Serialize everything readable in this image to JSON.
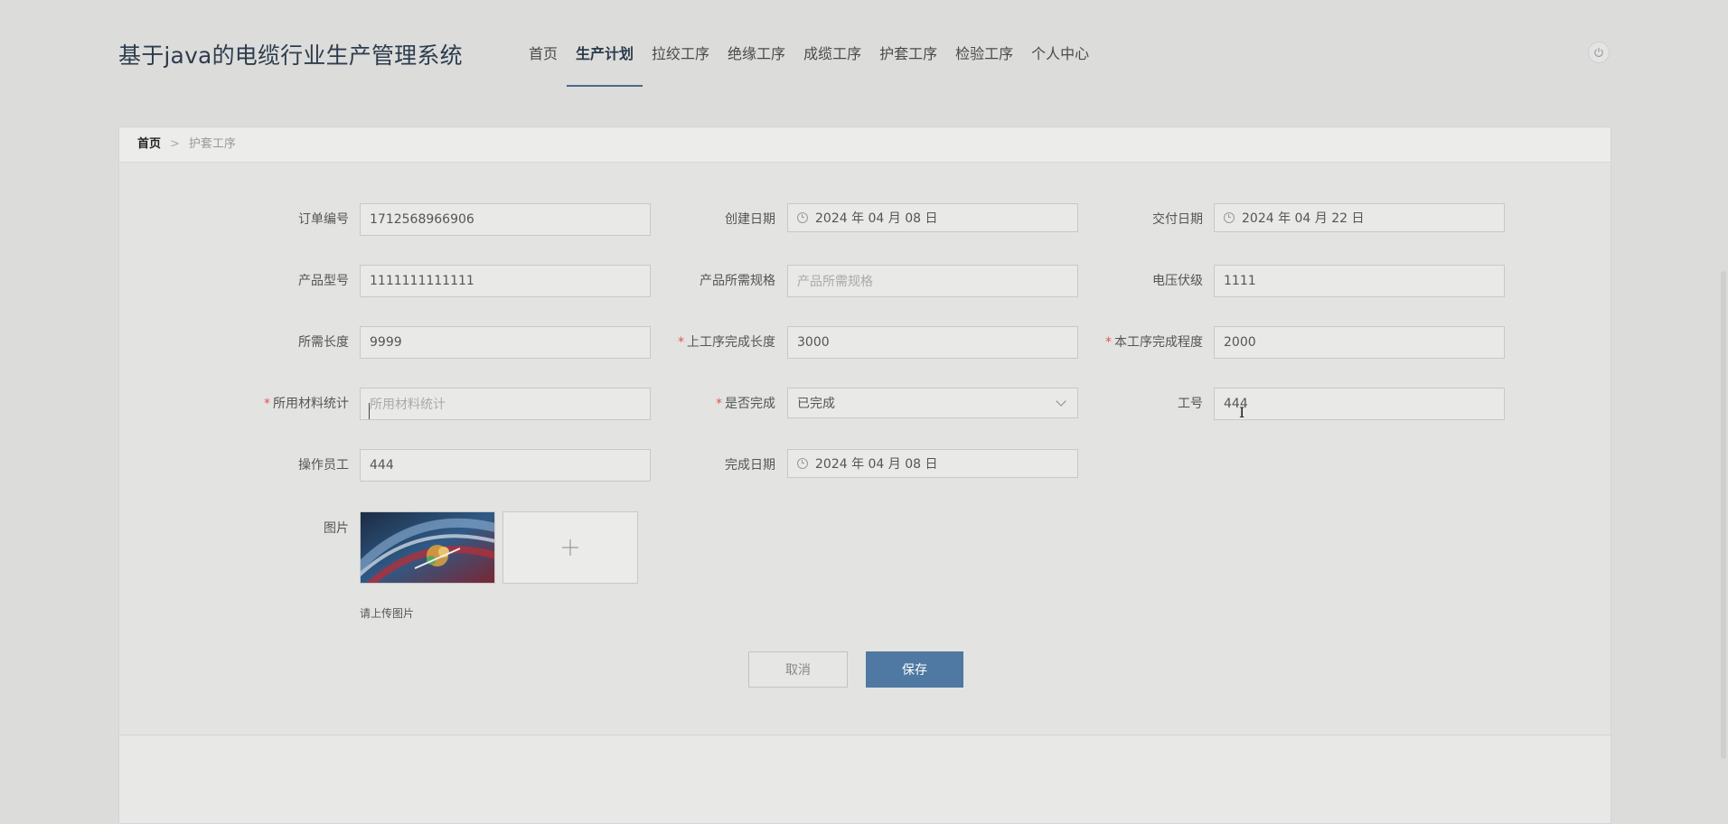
{
  "header": {
    "title": "基于java的电缆行业生产管理系统",
    "nav": [
      {
        "label": "首页",
        "active": false
      },
      {
        "label": "生产计划",
        "active": true
      },
      {
        "label": "拉绞工序",
        "active": false
      },
      {
        "label": "绝缘工序",
        "active": false
      },
      {
        "label": "成缆工序",
        "active": false
      },
      {
        "label": "护套工序",
        "active": false
      },
      {
        "label": "检验工序",
        "active": false
      },
      {
        "label": "个人中心",
        "active": false
      }
    ]
  },
  "breadcrumb": {
    "home": "首页",
    "separator": ">",
    "current": "护套工序"
  },
  "form": {
    "order_no": {
      "label": "订单编号",
      "value": "1712568966906"
    },
    "create_date": {
      "label": "创建日期",
      "value": "2024 年 04 月 08 日"
    },
    "delivery_date": {
      "label": "交付日期",
      "value": "2024 年 04 月 22 日"
    },
    "product_model": {
      "label": "产品型号",
      "value": "1111111111111"
    },
    "product_spec": {
      "label": "产品所需规格",
      "placeholder": "产品所需规格"
    },
    "voltage": {
      "label": "电压伏级",
      "value": "1111"
    },
    "required_length": {
      "label": "所需长度",
      "value": "9999"
    },
    "prev_length": {
      "label": "上工序完成长度",
      "value": "3000"
    },
    "this_progress": {
      "label": "本工序完成程度",
      "value": "2000"
    },
    "material_stats": {
      "label": "所用材料统计",
      "placeholder": "所用材料统计"
    },
    "is_done": {
      "label": "是否完成",
      "value": "已完成"
    },
    "work_no": {
      "label": "工号",
      "value": "444"
    },
    "operator": {
      "label": "操作员工",
      "value": "444"
    },
    "finish_date": {
      "label": "完成日期",
      "value": "2024 年 04 月 08 日"
    },
    "picture": {
      "label": "图片",
      "hint": "请上传图片"
    }
  },
  "buttons": {
    "cancel": "取消",
    "save": "保存"
  },
  "colors": {
    "primary": "#4f78a2",
    "required": "#e05656",
    "background": "#dcdcdb"
  }
}
